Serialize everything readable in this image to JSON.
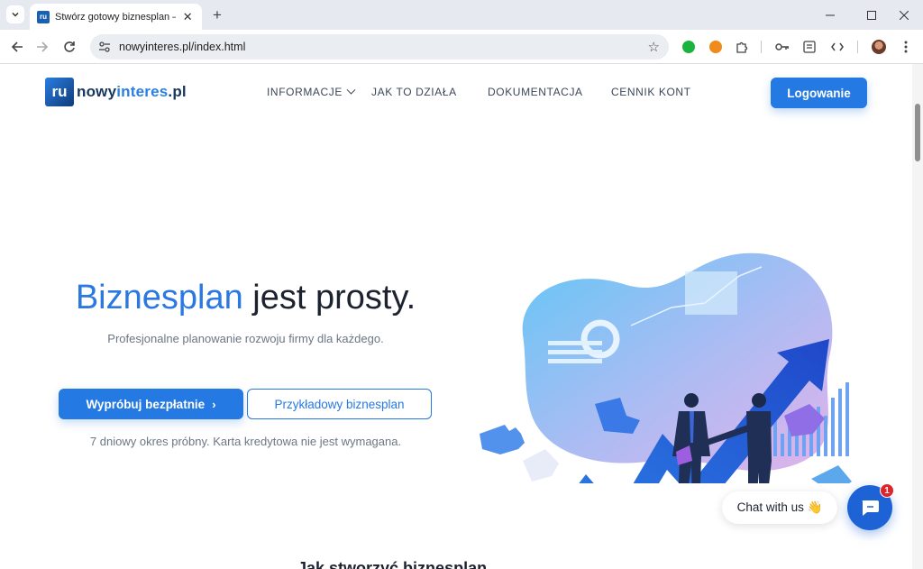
{
  "browser": {
    "tab_title": "Stwórz gotowy biznesplan – szybko",
    "favicon_text": "ru",
    "url": "nowyinteres.pl/index.html"
  },
  "site": {
    "logo_prefix": "nowy",
    "logo_accent": "interes",
    "logo_suffix": ".pl",
    "logo_mark": "ru",
    "nav": {
      "info": "INFORMACJE",
      "how": "JAK TO DZIAŁA",
      "docs": "DOKUMENTACJA",
      "pricing": "CENNIK KONT"
    },
    "login": "Logowanie"
  },
  "hero": {
    "title_blue": "Biznesplan",
    "title_rest": " jest prosty.",
    "subtitle": "Profesjonalne planowanie rozwoju firmy dla każdego.",
    "cta_primary": "Wypróbuj bezpłatnie",
    "cta_secondary": "Przykładowy biznesplan",
    "note": "7 dniowy okres próbny. Karta kredytowa nie jest wymagana."
  },
  "chat": {
    "bubble": "Chat with us 👋",
    "badge": "1"
  },
  "next_heading": "Jak stworzyć biznesplan"
}
